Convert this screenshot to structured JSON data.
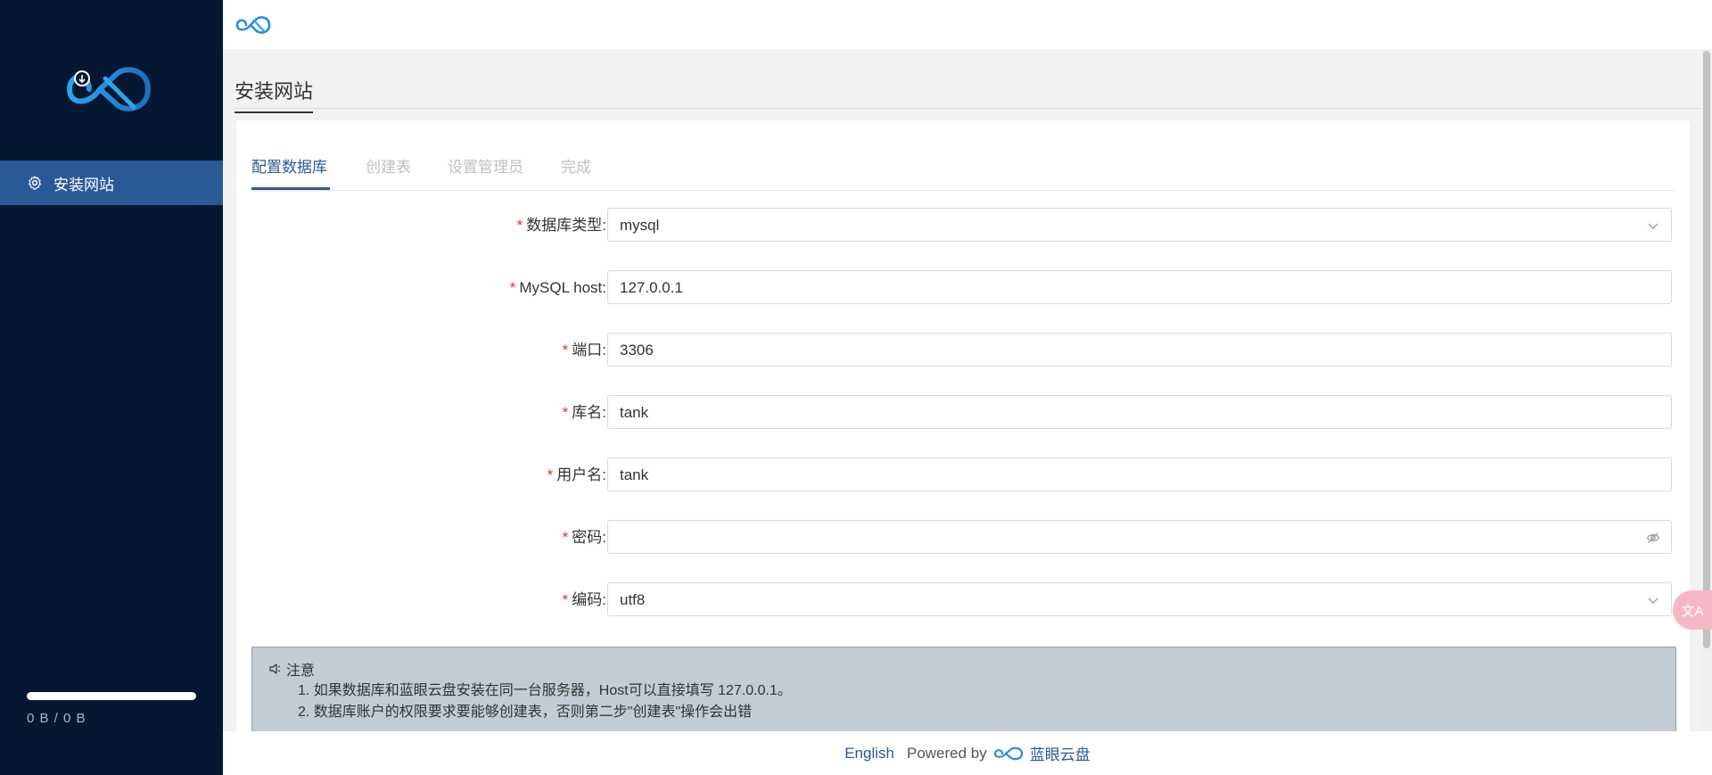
{
  "app": {
    "brand_color": "#2a5a96",
    "sidebar_color": "#061831"
  },
  "sidebar": {
    "logo_icon": "cloud-infinity-logo",
    "items": [
      {
        "label": "安装网站",
        "icon": "gear-icon"
      }
    ],
    "storage": {
      "text": "0 B / 0 B",
      "used_fraction": 1.0
    }
  },
  "header": {
    "logo_icon": "infinity-logo"
  },
  "main": {
    "title": "安装网站",
    "tabs": [
      {
        "label": "配置数据库",
        "active": true
      },
      {
        "label": "创建表",
        "active": false
      },
      {
        "label": "设置管理员",
        "active": false
      },
      {
        "label": "完成",
        "active": false
      }
    ],
    "form": {
      "required_mark": "*",
      "fields": [
        {
          "label": "数据库类型:",
          "value": "mysql",
          "type": "select"
        },
        {
          "label": "MySQL host:",
          "value": "127.0.0.1",
          "type": "text"
        },
        {
          "label": "端口:",
          "value": "3306",
          "type": "text"
        },
        {
          "label": "库名:",
          "value": "tank",
          "type": "text"
        },
        {
          "label": "用户名:",
          "value": "tank",
          "type": "text"
        },
        {
          "label": "密码:",
          "value": "",
          "type": "password"
        },
        {
          "label": "编码:",
          "value": "utf8",
          "type": "select"
        }
      ]
    },
    "notice": {
      "title": "注意",
      "lines": [
        "1. 如果数据库和蓝眼云盘安装在同一台服务器，Host可以直接填写 127.0.0.1。",
        "2. 数据库账户的权限要求要能够创建表，否则第二步\"创建表\"操作会出错"
      ]
    }
  },
  "footer": {
    "language": "English",
    "powered_by": "Powered by",
    "brand": "蓝眼云盘"
  },
  "floating": {
    "translate_label": "文A"
  }
}
